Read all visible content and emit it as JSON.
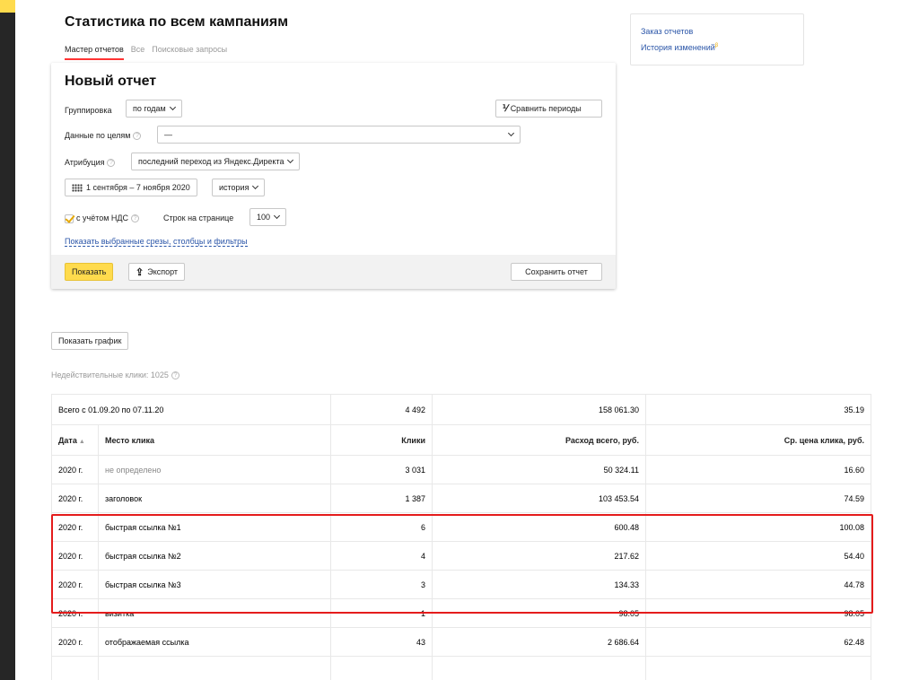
{
  "page": {
    "title": "Статистика по всем кампаниям",
    "tabs": [
      {
        "label": "Мастер отчетов",
        "active": true
      },
      {
        "label": "Все",
        "active": false
      },
      {
        "label": "Поисковые запросы",
        "active": false
      }
    ]
  },
  "report": {
    "title": "Новый отчет",
    "grouping_label": "Группировка",
    "grouping_value": "по годам",
    "compare_label": "Сравнить периоды",
    "goals_label": "Данные по целям",
    "goals_value": "—",
    "attribution_label": "Атрибуция",
    "attribution_value": "последний переход из Яндекс.Директа",
    "date_range": "1 сентября – 7 ноября 2020",
    "history_label": "история",
    "vat_label": "с учётом НДС",
    "rows_label": "Строк на странице",
    "rows_value": "100",
    "show_slices_link": "Показать выбранные срезы, столбцы и фильтры",
    "show_button": "Показать",
    "export_button": "Экспорт",
    "save_button": "Сохранить отчет"
  },
  "sidebar": {
    "links": [
      {
        "label": "Заказ отчетов"
      },
      {
        "label": "История изменений"
      }
    ],
    "beta_mark": "β"
  },
  "show_chart_button": "Показать график",
  "invalid_clicks": "Недействительные клики: 1025",
  "table": {
    "total": {
      "label": "Всего с 01.09.20 по 07.11.20",
      "clicks": "4 492",
      "spend": "158 061.30",
      "cpc": "35.19"
    },
    "columns": {
      "date": "Дата",
      "date_sort": "▲",
      "place": "Место клика",
      "clicks": "Клики",
      "spend": "Расход всего, руб.",
      "cpc": "Ср. цена клика, руб."
    },
    "rows": [
      {
        "date": "2020 г.",
        "place": "не определено",
        "clicks": "3 031",
        "spend": "50 324.11",
        "cpc": "16.60",
        "muted": true
      },
      {
        "date": "2020 г.",
        "place": "заголовок",
        "clicks": "1 387",
        "spend": "103 453.54",
        "cpc": "74.59"
      },
      {
        "date": "2020 г.",
        "place": "быстрая ссылка №1",
        "clicks": "6",
        "spend": "600.48",
        "cpc": "100.08"
      },
      {
        "date": "2020 г.",
        "place": "быстрая ссылка №2",
        "clicks": "4",
        "spend": "217.62",
        "cpc": "54.40"
      },
      {
        "date": "2020 г.",
        "place": "быстрая ссылка №3",
        "clicks": "3",
        "spend": "134.33",
        "cpc": "44.78"
      },
      {
        "date": "2020 г.",
        "place": "визитка",
        "clicks": "1",
        "spend": "98.05",
        "cpc": "98.05"
      },
      {
        "date": "2020 г.",
        "place": "отображаемая ссылка",
        "clicks": "43",
        "spend": "2 686.64",
        "cpc": "62.48"
      },
      {
        "date": "",
        "place": "",
        "clicks": "",
        "spend": "",
        "cpc": ""
      }
    ]
  },
  "colors": {
    "accent_yellow": "#ffdb4d",
    "link_blue": "#2a55a8",
    "highlight_red": "#e41c1c",
    "tab_active_red": "#ff3333"
  }
}
